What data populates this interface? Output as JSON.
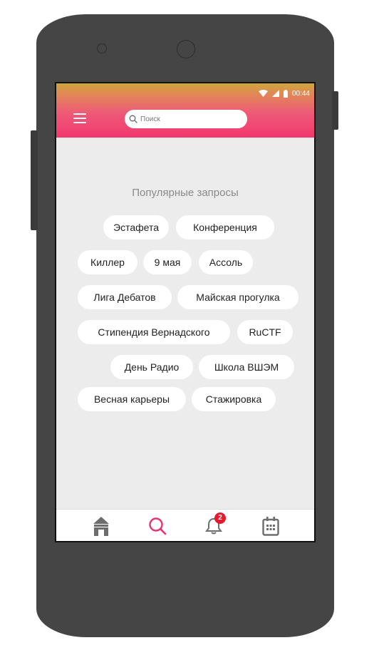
{
  "status_bar": {
    "time": "00:44"
  },
  "search": {
    "placeholder": "Поиск"
  },
  "popular": {
    "heading": "Популярные запросы",
    "chips": [
      "Эстафета",
      "Конференция",
      "Киллер",
      "9 мая",
      "Ассоль",
      "Лига Дебатов",
      "Майская прогулка",
      "Стипендия Вернадского",
      "RuCTF",
      "День Радио",
      "Школа ВШЭМ",
      "Весная карьеры",
      "Стажировка"
    ]
  },
  "bottom_nav": {
    "items": [
      "home-icon",
      "search-icon",
      "bell-icon",
      "calendar-icon"
    ],
    "notifications_count": "2",
    "active_color": "#e8336d",
    "inactive_color": "#6d6d6d"
  },
  "colors": {
    "accent": "#f2376f",
    "screen_bg": "#ececec",
    "phone_body": "#454545"
  }
}
